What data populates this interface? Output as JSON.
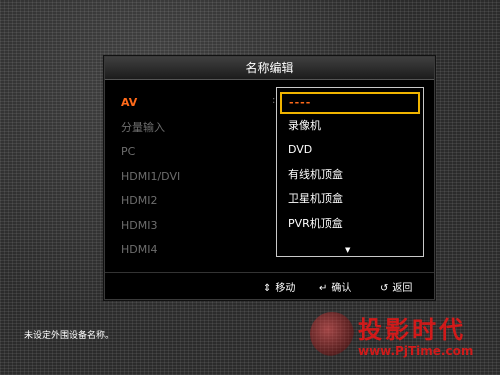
{
  "dialog": {
    "title": "名称编辑",
    "sources": [
      {
        "label": "AV",
        "active": true
      },
      {
        "label": "分量输入",
        "active": false
      },
      {
        "label": "PC",
        "active": false
      },
      {
        "label": "HDMI1/DVI",
        "active": false
      },
      {
        "label": "HDMI2",
        "active": false
      },
      {
        "label": "HDMI3",
        "active": false
      },
      {
        "label": "HDMI4",
        "active": false
      }
    ],
    "colon": ":",
    "dropdown": {
      "selected": "----",
      "options": [
        "录像机",
        "DVD",
        "有线机顶盒",
        "卫星机顶盒",
        "PVR机顶盒"
      ],
      "more_indicator": "▼"
    },
    "footer": {
      "move_icon": "updown-arrows-icon",
      "move_label": "移动",
      "confirm_icon": "enter-icon",
      "confirm_label": "确认",
      "back_icon": "return-icon",
      "back_label": "返回"
    }
  },
  "status_text": "未设定外围设备名称。",
  "watermark": {
    "title": "投影时代",
    "url": "www.PjTime.com"
  },
  "colors": {
    "accent": "#ff6a1a",
    "highlight_border": "#f0b400",
    "watermark": "#d11a1a"
  }
}
